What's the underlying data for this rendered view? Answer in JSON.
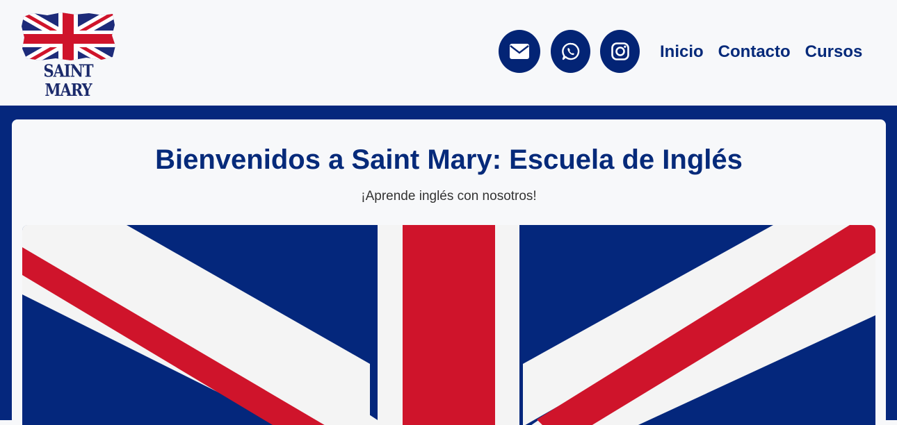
{
  "header": {
    "logo": {
      "text": "SAINT MARY",
      "icon": "union-jack-flag"
    },
    "social": [
      {
        "name": "email",
        "icon": "envelope-icon"
      },
      {
        "name": "whatsapp",
        "icon": "whatsapp-icon"
      },
      {
        "name": "instagram",
        "icon": "instagram-icon"
      }
    ],
    "nav": [
      {
        "label": "Inicio"
      },
      {
        "label": "Contacto"
      },
      {
        "label": "Cursos"
      }
    ]
  },
  "main": {
    "title": "Bienvenidos a Saint Mary: Escuela de Inglés",
    "subtitle": "¡Aprende inglés con nosotros!",
    "hero_image": "union-jack-flag"
  },
  "colors": {
    "brand_blue": "#032475",
    "flag_red": "#cf142b",
    "flag_white": "#f4f4f4",
    "page_bg": "#f7f8fa"
  }
}
